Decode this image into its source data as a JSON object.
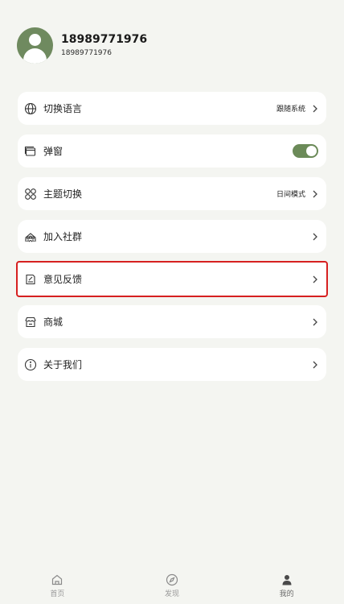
{
  "profile": {
    "name": "18989771976",
    "subtitle": "18989771976",
    "avatar_color": "#6f8a5f"
  },
  "menu": {
    "items": [
      {
        "label": "切换语言",
        "value": "跟随系统",
        "icon": "globe-icon"
      },
      {
        "label": "弹窗",
        "toggle": "on",
        "icon": "window-icon"
      },
      {
        "label": "主题切换",
        "value": "日间模式",
        "icon": "theme-grid-icon"
      },
      {
        "label": "加入社群",
        "icon": "community-icon"
      },
      {
        "label": "意见反馈",
        "icon": "feedback-icon",
        "highlighted": true
      },
      {
        "label": "商城",
        "icon": "store-icon"
      },
      {
        "label": "关于我们",
        "icon": "info-icon"
      }
    ]
  },
  "tabbar": {
    "tabs": [
      {
        "label": "首页",
        "icon": "home-icon"
      },
      {
        "label": "发现",
        "icon": "compass-icon"
      },
      {
        "label": "我的",
        "icon": "user-icon",
        "active": true
      }
    ]
  },
  "colors": {
    "accent": "#6b8a58",
    "highlight_border": "#d62020",
    "background": "#f4f5f1"
  }
}
